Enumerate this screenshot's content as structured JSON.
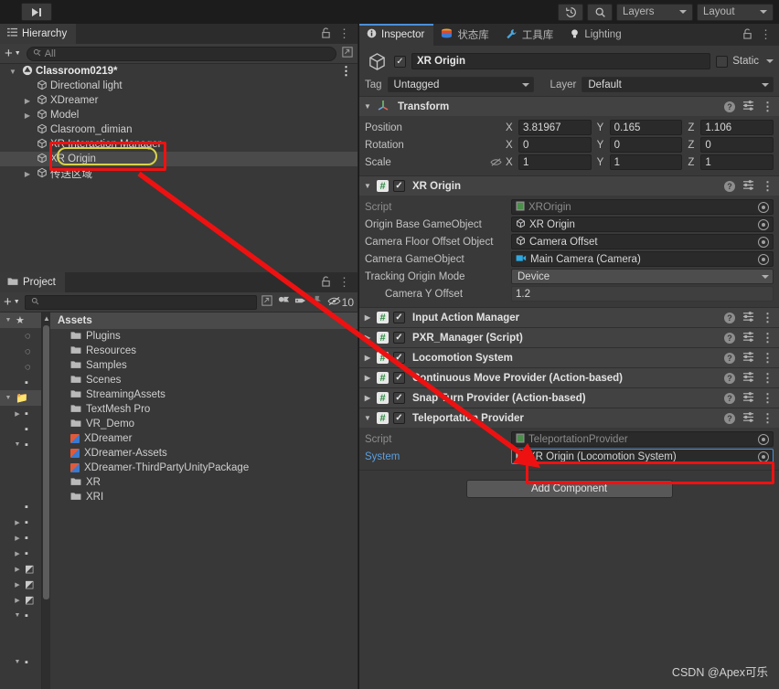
{
  "toolbar": {
    "step_icon": "step-forward-icon",
    "history_icon": "history-icon",
    "search_icon": "search-icon",
    "layers_label": "Layers",
    "layout_label": "Layout"
  },
  "hierarchy": {
    "tab_label": "Hierarchy",
    "tab_icon": "hierarchy-icon",
    "lock_icon": "lock-icon",
    "menu_icon": "kebab-menu-icon",
    "add_label": "+",
    "search_placeholder": "All",
    "items": [
      {
        "label": "Classroom0219*",
        "depth": 0,
        "twisty": "down",
        "icon": "unity-scene-icon",
        "selected": false,
        "root": true
      },
      {
        "label": "Directional light",
        "depth": 1,
        "twisty": "",
        "icon": "gameobject-icon",
        "selected": false,
        "root": false
      },
      {
        "label": "XDreamer",
        "depth": 1,
        "twisty": "right",
        "icon": "gameobject-icon",
        "selected": false,
        "root": false
      },
      {
        "label": "Model",
        "depth": 1,
        "twisty": "right",
        "icon": "gameobject-icon",
        "selected": false,
        "root": false
      },
      {
        "label": "Clasroom_dimian",
        "depth": 1,
        "twisty": "",
        "icon": "gameobject-icon",
        "selected": false,
        "root": false
      },
      {
        "label": "XR Interaction Manager",
        "depth": 1,
        "twisty": "",
        "icon": "gameobject-icon",
        "selected": false,
        "root": false
      },
      {
        "label": "XR Origin",
        "depth": 1,
        "twisty": "",
        "icon": "gameobject-icon",
        "selected": true,
        "root": false
      },
      {
        "label": "传送区域",
        "depth": 1,
        "twisty": "right",
        "icon": "gameobject-icon",
        "selected": false,
        "root": false
      }
    ]
  },
  "project": {
    "tab_label": "Project",
    "tab_icon": "folder-icon",
    "lock_icon": "lock-icon",
    "menu_icon": "kebab-menu-icon",
    "add_label": "+",
    "search_placeholder": "",
    "hidden_count": "10",
    "toolbar_icons": [
      "search-icon",
      "save-search-icon",
      "packages-icon",
      "label-icon",
      "pin-icon",
      "hidden-eye-icon"
    ],
    "assets_header": "Assets",
    "folders": [
      {
        "label": "Plugins",
        "icon": "folder-icon"
      },
      {
        "label": "Resources",
        "icon": "folder-icon"
      },
      {
        "label": "Samples",
        "icon": "folder-icon"
      },
      {
        "label": "Scenes",
        "icon": "folder-icon"
      },
      {
        "label": "StreamingAssets",
        "icon": "folder-icon"
      },
      {
        "label": "TextMesh Pro",
        "icon": "folder-icon"
      },
      {
        "label": "VR_Demo",
        "icon": "folder-icon"
      },
      {
        "label": "XDreamer",
        "icon": "package-icon"
      },
      {
        "label": "XDreamer-Assets",
        "icon": "package-icon"
      },
      {
        "label": "XDreamer-ThirdPartyUnityPackage",
        "icon": "package-icon"
      },
      {
        "label": "XR",
        "icon": "folder-icon"
      },
      {
        "label": "XRI",
        "icon": "folder-icon"
      }
    ]
  },
  "inspector": {
    "tabs": [
      {
        "label": "Inspector",
        "icon": "info-icon",
        "active": true
      },
      {
        "label": "状态库",
        "icon": "database-icon",
        "active": false
      },
      {
        "label": "工具库",
        "icon": "wrench-icon",
        "active": false
      },
      {
        "label": "Lighting",
        "icon": "lightbulb-icon",
        "active": false
      }
    ],
    "lock_icon": "lock-icon",
    "menu_icon": "kebab-menu-icon",
    "object": {
      "icon": "gameobject-icon",
      "enabled": true,
      "name": "XR Origin",
      "static_label": "Static",
      "static_checked": false,
      "tag_label": "Tag",
      "tag_value": "Untagged",
      "layer_label": "Layer",
      "layer_value": "Default"
    },
    "transform": {
      "title": "Transform",
      "icon": "transform-axis-icon",
      "expanded": true,
      "rows": [
        {
          "label": "Position",
          "x": "3.81967",
          "y": "0.165",
          "z": "1.106",
          "lock_icon": ""
        },
        {
          "label": "Rotation",
          "x": "0",
          "y": "0",
          "z": "0",
          "lock_icon": ""
        },
        {
          "label": "Scale",
          "x": "1",
          "y": "1",
          "z": "1",
          "lock_icon": "constrain-proportions-off-icon"
        }
      ],
      "axis_labels": [
        "X",
        "Y",
        "Z"
      ]
    },
    "xr_origin": {
      "title": "XR Origin",
      "expanded": true,
      "enabled": true,
      "props": [
        {
          "label": "Script",
          "value": "XROrigin",
          "icon": "script-icon",
          "dim": true
        },
        {
          "label": "Origin Base GameObject",
          "value": "XR Origin",
          "icon": "gameobject-icon",
          "dim": false
        },
        {
          "label": "Camera Floor Offset Object",
          "value": "Camera Offset",
          "icon": "gameobject-icon",
          "dim": false
        },
        {
          "label": "Camera GameObject",
          "value": "Main Camera (Camera)",
          "icon": "camera-icon",
          "dim": false
        }
      ],
      "tracking_label": "Tracking Origin Mode",
      "tracking_value": "Device",
      "camera_y_label": "Camera Y Offset",
      "camera_y_value": "1.2"
    },
    "collapsed_components": [
      {
        "title": "Input Action Manager",
        "enabled": true
      },
      {
        "title": "PXR_Manager (Script)",
        "enabled": true
      },
      {
        "title": "Locomotion System",
        "enabled": true
      },
      {
        "title": "Continuous Move Provider (Action-based)",
        "enabled": true
      },
      {
        "title": "Snap Turn Provider (Action-based)",
        "enabled": true
      }
    ],
    "teleportation": {
      "title": "Teleportation Provider",
      "expanded": true,
      "enabled": true,
      "script_label": "Script",
      "script_value": "TeleportationProvider",
      "system_label": "System",
      "system_value": "XR Origin (Locomotion System)"
    },
    "add_component_label": "Add Component"
  },
  "annotations": {
    "watermark": "CSDN @Apex可乐",
    "highlight_color": "#ee1111",
    "pill_color": "#d8d24a",
    "arrow_color": "#ee1111"
  }
}
